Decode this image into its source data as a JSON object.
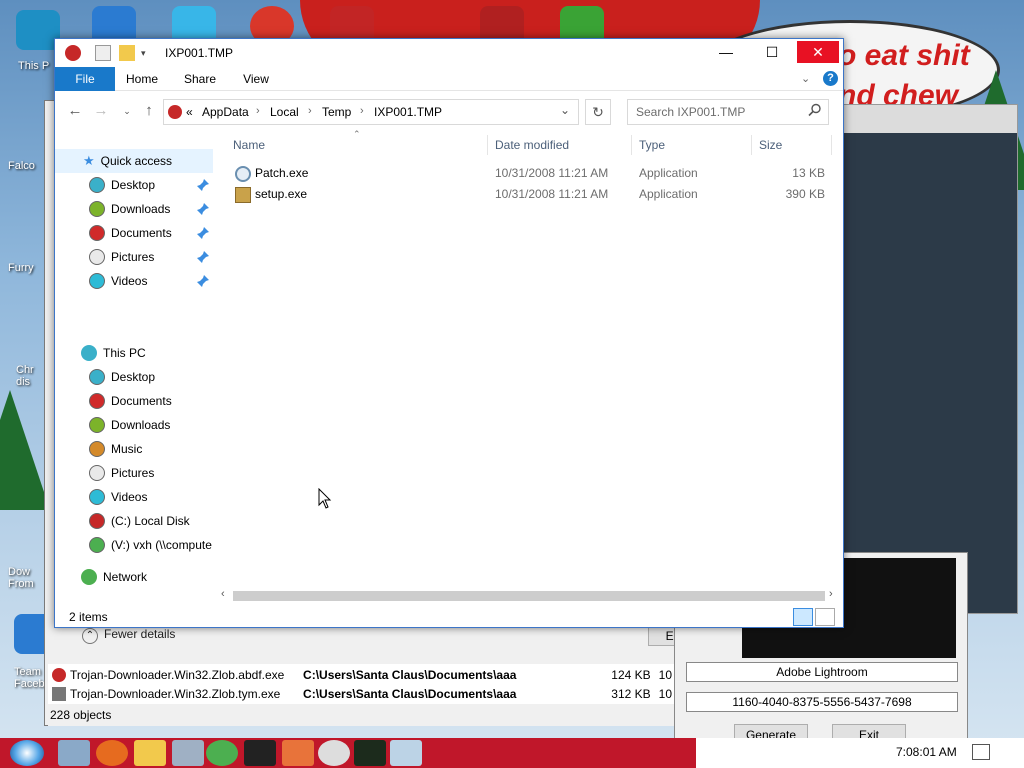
{
  "explorer": {
    "title": "IXP001.TMP",
    "ribbon_tabs": [
      "File",
      "Home",
      "Share",
      "View"
    ],
    "breadcrumb": [
      "AppData",
      "Local",
      "Temp",
      "IXP001.TMP"
    ],
    "breadcrumb_prefix": "«",
    "search_placeholder": "Search IXP001.TMP",
    "columns": [
      "Name",
      "Date modified",
      "Type",
      "Size"
    ],
    "files": [
      {
        "name": "Patch.exe",
        "date": "10/31/2008 11:21 AM",
        "type": "Application",
        "size": "13 KB",
        "icon": "app-gear-icon"
      },
      {
        "name": "setup.exe",
        "date": "10/31/2008 11:21 AM",
        "type": "Application",
        "size": "390 KB",
        "icon": "installer-box-icon"
      }
    ],
    "status": "2 items",
    "nav": {
      "quick_access": "Quick access",
      "quick_items": [
        {
          "label": "Desktop",
          "color": "#3ab0c9"
        },
        {
          "label": "Downloads",
          "color": "#7cb32a"
        },
        {
          "label": "Documents",
          "color": "#d02a2a"
        },
        {
          "label": "Pictures",
          "color": "#e9e9e9"
        },
        {
          "label": "Videos",
          "color": "#2ebbd6"
        }
      ],
      "this_pc": "This PC",
      "pc_items": [
        {
          "label": "Desktop",
          "color": "#3ab0c9"
        },
        {
          "label": "Documents",
          "color": "#d02a2a"
        },
        {
          "label": "Downloads",
          "color": "#7cb32a"
        },
        {
          "label": "Music",
          "color": "#d48a2a"
        },
        {
          "label": "Pictures",
          "color": "#e9e9e9"
        },
        {
          "label": "Videos",
          "color": "#2ebbd6"
        },
        {
          "label": "(C:) Local Disk",
          "color": "#c62828"
        },
        {
          "label": "(V:) vxh (\\\\compute",
          "color": "#4caf50"
        }
      ],
      "network": "Network"
    }
  },
  "taskmanager": {
    "fewer_details": "Fewer details",
    "end_task": "End task",
    "rows": [
      {
        "name": "Trojan-Downloader.Win32.Zlob.abdf.exe",
        "path": "C:\\Users\\Santa Claus\\Documents\\aaa",
        "size": "124 KB",
        "extra": "10"
      },
      {
        "name": "Trojan-Downloader.Win32.Zlob.tym.exe",
        "path": "C:\\Users\\Santa Claus\\Documents\\aaa",
        "size": "312 KB",
        "extra": "10"
      }
    ],
    "status": "228 objects"
  },
  "keygen": {
    "product": "Adobe Lightroom",
    "serial": "1160-4040-8375-5556-5437-7698",
    "generate": "Generate",
    "exit": "Exit"
  },
  "desktop": {
    "speech_line1": "o eat shit",
    "speech_line2": "nd chew",
    "labels": [
      "This P",
      "Falco",
      "Furry",
      "Chr dis",
      "Dow From",
      "Team Faceb"
    ]
  },
  "taskbar": {
    "clock": "7:08:01 AM"
  },
  "colors": {
    "accent": "#1979ca",
    "taskbar": "#c0172a",
    "close": "#e81123"
  }
}
